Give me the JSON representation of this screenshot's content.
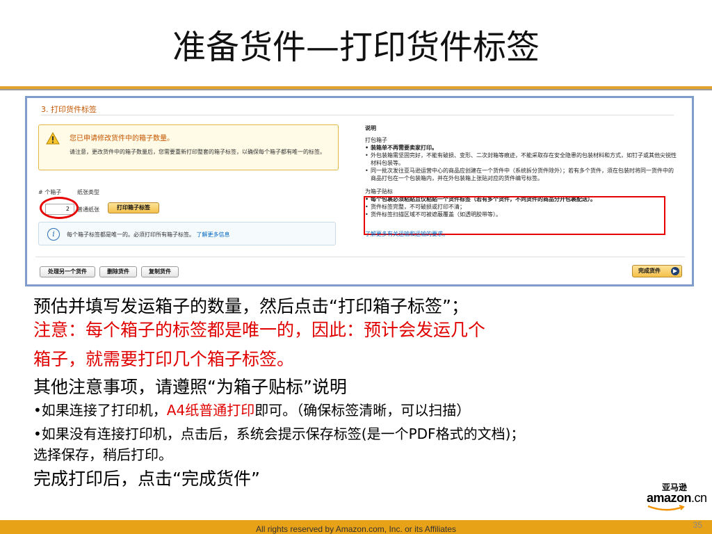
{
  "slide": {
    "title": "准备货件—打印货件标签"
  },
  "screenshot": {
    "section_title": "3. 打印货件标签",
    "warning": {
      "heading": "您已申请修改货件中的箱子数量。",
      "body": "请注意，更改货件中的箱子数量后，您需要重新打印整套的箱子标签，以确保每个箱子都有唯一的标签。"
    },
    "columns": {
      "box_count_label": "# 个箱子",
      "paper_type_label": "纸张类型"
    },
    "box_count_value": "2",
    "paper_type_value": "普通纸张",
    "print_button": "打印箱子标签",
    "info": {
      "text": "每个箱子标签都是唯一的。必须打印所有箱子标签。",
      "link": "了解更多信息"
    },
    "notes": {
      "title": "说明",
      "packing_heading": "打包箱子",
      "packing_items": [
        "装箱单不再需要卖家打印。",
        "外包装箱需坚固完好，不能有破损、变形、二次封箱等痕迹，不能采取存在安全隐患的包装材料和方式，如钉子或其他尖锐性材料包装等。",
        "同一批次发往亚马逊运营中心的商品应创建在一个货件中（系统拆分货件除外）；若有多个货件，须在包装时将同一货件中的商品打包在一个包装箱内，并在外包装箱上张贴对应的货件编号标签。"
      ],
      "labeling_heading": "为箱子贴标",
      "labeling_items": [
        "每个包裹必须粘贴且仅粘贴一个货件标签（若有多个货件，不同货件的商品分开包裹配送）。",
        "货件标签完整，不可破损或打印不清；",
        "货件标签扫描区域不可被遮蔽覆盖（如透明胶带等）。"
      ],
      "link": "了解更多有关运输和运输的要求。"
    },
    "buttons": {
      "process_another": "处理另一个货件",
      "delete": "删除货件",
      "copy": "复制货件",
      "finish": "完成货件"
    }
  },
  "body": {
    "line1": "预估并填写发运箱子的数量，然后点击“打印箱子标签”；",
    "line2": "注意：每个箱子的标签都是唯一的，因此：预计会发运几个",
    "line3": "箱子，就需要打印几个箱子标签。",
    "line4": "其他注意事项，请遵照“为箱子贴标”说明",
    "bullet1_pre": "•如果连接了打印机，",
    "bullet1_red": "A4纸普通打印",
    "bullet1_post": "即可。（确保标签清晰，可以扫描）",
    "bullet2": "•如果没有连接打印机，点击后，系统会提示保存标签(是一个PDF格式的文档)；",
    "bullet2_cont": "选择保存，稍后打印。",
    "line5": "完成打印后，点击“完成货件”"
  },
  "logo": {
    "cn": "亚马逊",
    "main": "amazon",
    "suffix": ".cn"
  },
  "footer": {
    "copyright": "All rights reserved by Amazon.com, Inc. or its Affiliates",
    "page_number": "35"
  },
  "colors": {
    "accent_orange": "#e8a218",
    "highlight_red": "#e60000",
    "frame_blue": "#7e9ccc"
  }
}
